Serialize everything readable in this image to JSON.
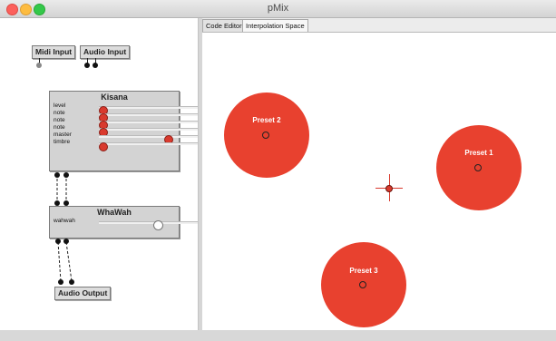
{
  "window": {
    "title": "pMix"
  },
  "colors": {
    "preset_fill": "#e8412f",
    "knob": "#d93a2e",
    "node_bg": "#d3d3d3"
  },
  "graph": {
    "midi_input": "Midi Input",
    "audio_input": "Audio Input",
    "audio_output": "Audio Output",
    "kisana": {
      "title": "Kisana",
      "params": [
        {
          "label": "level",
          "value": 0.0
        },
        {
          "label": "note",
          "value": 0.0
        },
        {
          "label": "note",
          "value": 0.0
        },
        {
          "label": "note",
          "value": 0.0
        },
        {
          "label": "master",
          "value": 0.6
        },
        {
          "label": "timbre",
          "value": 0.0
        }
      ]
    },
    "whawah": {
      "title": "WhaWah",
      "params": [
        {
          "label": "wahwah",
          "value": 0.5
        }
      ]
    }
  },
  "tabs": [
    {
      "label": "Code Editor",
      "active": false
    },
    {
      "label": "Interpolation Space",
      "active": true
    }
  ],
  "presets": [
    {
      "label": "Preset 1"
    },
    {
      "label": "Preset 2"
    },
    {
      "label": "Preset 3"
    }
  ],
  "icons": {
    "cursor": "crosshair-icon",
    "preset_center": "circle-outline-icon"
  }
}
